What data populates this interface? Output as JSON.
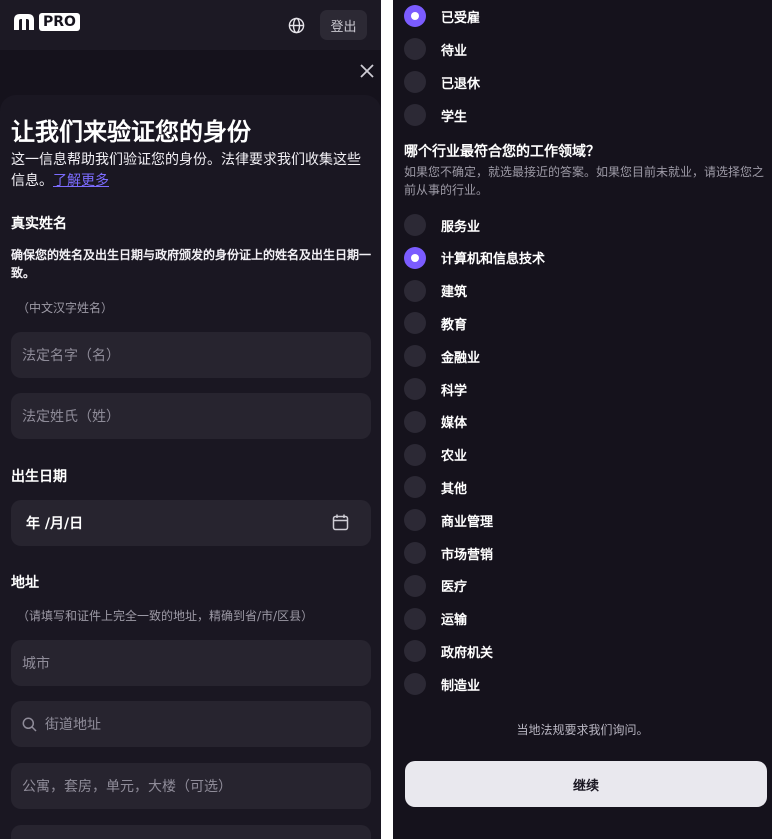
{
  "header": {
    "logo_text": "PRO",
    "logout_label": "登出"
  },
  "form": {
    "title": "让我们来验证您的身份",
    "description": "这一信息帮助我们验证您的身份。法律要求我们收集这些信息。",
    "learn_more": "了解更多",
    "legal_name": {
      "label": "真实姓名",
      "note": "确保您的姓名及出生日期与政府颁发的身份证上的姓名及出生日期一致。",
      "hint": "（中文汉字姓名）",
      "first_placeholder": "法定名字（名）",
      "last_placeholder": "法定姓氏（姓）"
    },
    "dob": {
      "label": "出生日期",
      "value": "年 /月/日"
    },
    "address": {
      "label": "地址",
      "hint": "（请填写和证件上完全一致的地址，精确到省/市/区县）",
      "city_placeholder": "城市",
      "street_placeholder": "街道地址",
      "apt_placeholder": "公寓，套房，单元，大楼（可选）"
    }
  },
  "employment": {
    "options": [
      {
        "label": "已受雇",
        "selected": true
      },
      {
        "label": "待业",
        "selected": false
      },
      {
        "label": "已退休",
        "selected": false
      },
      {
        "label": "学生",
        "selected": false
      }
    ]
  },
  "industry": {
    "question": "哪个行业最符合您的工作领域？",
    "hint": "如果您不确定，就选最接近的答案。如果您目前未就业，请选择您之前从事的行业。",
    "options": [
      {
        "label": "服务业",
        "selected": false
      },
      {
        "label": "计算机和信息技术",
        "selected": true
      },
      {
        "label": "建筑",
        "selected": false
      },
      {
        "label": "教育",
        "selected": false
      },
      {
        "label": "金融业",
        "selected": false
      },
      {
        "label": "科学",
        "selected": false
      },
      {
        "label": "媒体",
        "selected": false
      },
      {
        "label": "农业",
        "selected": false
      },
      {
        "label": "其他",
        "selected": false
      },
      {
        "label": "商业管理",
        "selected": false
      },
      {
        "label": "市场营销",
        "selected": false
      },
      {
        "label": "医疗",
        "selected": false
      },
      {
        "label": "运输",
        "selected": false
      },
      {
        "label": "政府机关",
        "selected": false
      },
      {
        "label": "制造业",
        "selected": false
      }
    ]
  },
  "footer": {
    "law_note": "当地法规要求我们询问。",
    "continue_label": "继续"
  },
  "colors": {
    "accent": "#7b5cff",
    "link": "#7c6cff",
    "background": "#15121c",
    "input": "#27242f"
  }
}
